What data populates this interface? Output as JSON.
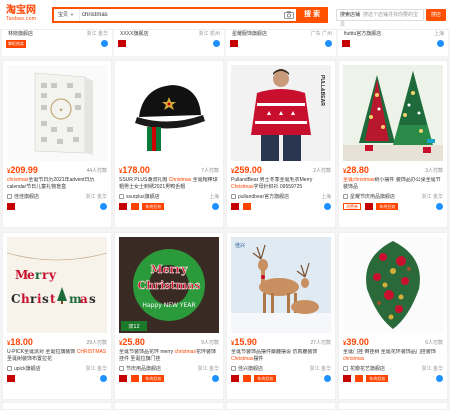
{
  "header": {
    "logo_cn": "淘宝网",
    "logo_en": "Taobao.com",
    "search_type": "宝贝",
    "search_query": "christmas",
    "search_button": "搜 索",
    "shop_search_value": "搜索店铺",
    "shop_search_placeholder": "搜这个店铺寻找你要的宝贝",
    "shop_button": "搜店"
  },
  "prev_row": [
    {
      "shop": "林晓旗舰店",
      "loc": "浙江 金华",
      "badge": "掌柜热卖"
    },
    {
      "shop": "XXXX旗舰店",
      "loc": "浙江 杭州"
    },
    {
      "shop": "星耀服饰旗舰店",
      "loc": "广东 广州"
    },
    {
      "shop": "fiutttu官方旗舰店",
      "loc": "上海"
    }
  ],
  "products": [
    {
      "price": "209.99",
      "paid": "44人付款",
      "title_pre": "christmas",
      "title_hl": "",
      "title_post": "圣诞节日历2021年advent日历 calendar节日儿童礼物盲盒",
      "shop": "佳佳旗舰店",
      "loc": "浙江 金华",
      "tags": []
    },
    {
      "price": "178.00",
      "paid": "7人付款",
      "title_pre": "SSUR PLUS潮流礼帽 ",
      "title_hl": "Christmas",
      "title_post": " 圣诞帽棒球帽男士女士刺绣2021男鸭舌帽",
      "shop": "ssurplus旗舰店",
      "loc": "上海",
      "tags": [
        "天猫",
        "年终狂欢"
      ]
    },
    {
      "price": "259.00",
      "paid": "2人付款",
      "title_pre": "PullandBear 男士冬季圣诞毛衣Merry ",
      "title_hl": "Christmas",
      "title_post": "字母针织衫 09559725",
      "shop": "pullandbear官方旗舰店",
      "loc": "上海",
      "tags": [
        "天猫"
      ]
    },
    {
      "price": "28.80",
      "paid": "3人付款",
      "title_pre": "",
      "title_hl": "圣诞christmas",
      "title_post": "树小摆件 装饰品办公桌圣诞节装饰品",
      "shop": "星耀节庆用品旗舰店",
      "loc": "浙江 金华",
      "tags": [
        "天猫",
        "年终狂欢"
      ]
    },
    {
      "price": "18.00",
      "paid": "29人付款",
      "title_pre": "U-PICK圣诞派对 圣诞拉旗装饰 ",
      "title_hl": "CHRISTMAS",
      "title_post": " 圣诞树装饰布置拉花",
      "shop": "upick旗舰店",
      "loc": "浙江 金华",
      "tags": [
        "天猫"
      ]
    },
    {
      "price": "25.80",
      "paid": "9人付款",
      "title_pre": "圣诞节装饰品花环 merry ",
      "title_hl": "christmas",
      "title_post": "花环装饰 挂件 圣诞拉旗门挂",
      "shop": "节庆用品旗舰店",
      "loc": "浙江 金华",
      "tags": [
        "天猫",
        "年终狂欢"
      ]
    },
    {
      "price": "15.90",
      "paid": "27人付款",
      "title_pre": "圣诞节装饰品摆件麋鹿摆设 仿真鹿装饰 ",
      "title_hl": "Christmas",
      "title_post": "摆件",
      "shop": "佳兴旗舰店",
      "loc": "浙江 金华",
      "tags": [
        "天猫",
        "年终狂欢"
      ]
    },
    {
      "price": "39.00",
      "paid": "6人付款",
      "title_pre": "圣诞门挂 倒挂树 圣诞花环装饰品门挂装饰 ",
      "title_hl": "christmas",
      "title_post": "",
      "shop": "花瓣花艺旗舰店",
      "loc": "浙江 金华",
      "tags": [
        "天猫",
        "年终狂欢"
      ]
    }
  ],
  "colors": {
    "accent": "#ff5000",
    "price": "#ff4400",
    "tmall": "#c40000",
    "wangwang": "#1e90ff"
  }
}
